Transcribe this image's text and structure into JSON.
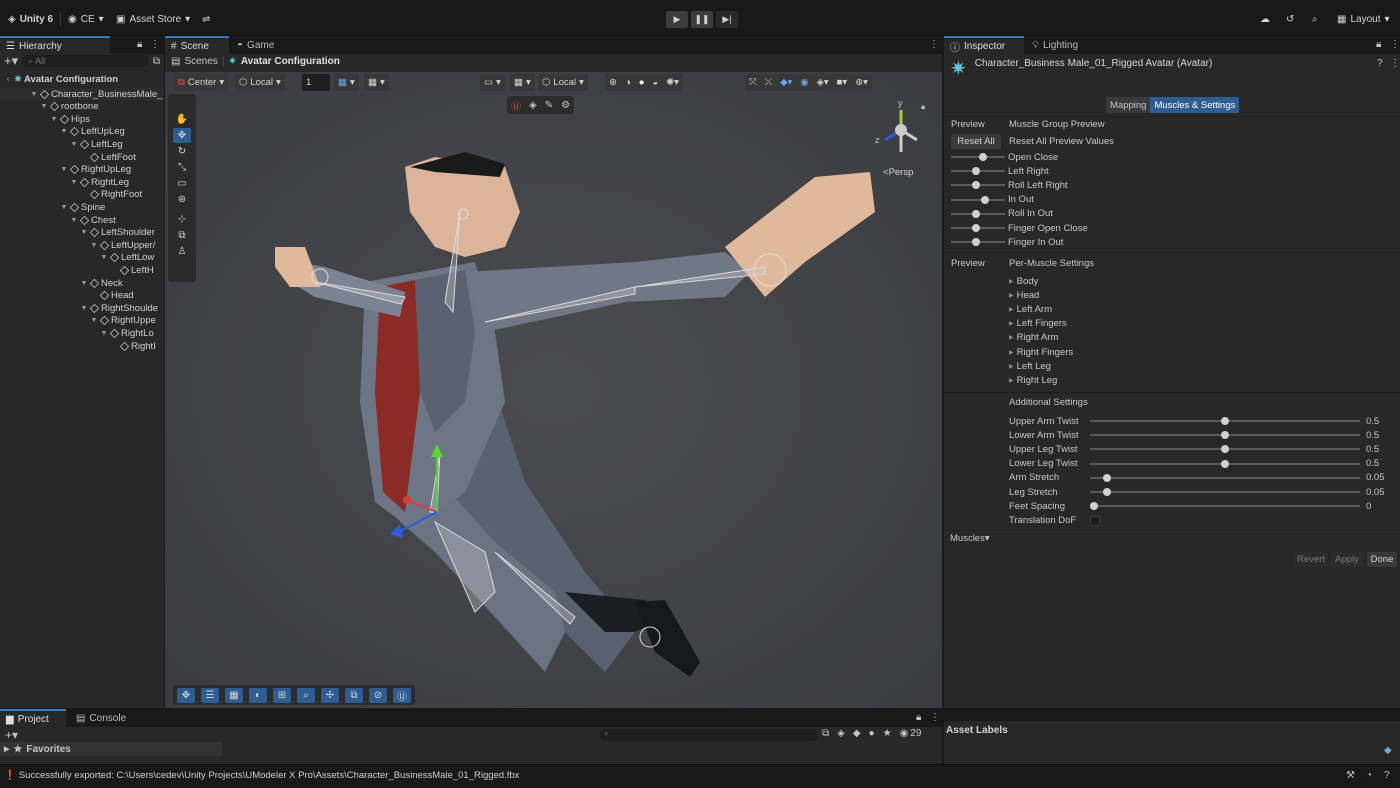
{
  "topbar": {
    "account": "Unity 6",
    "ce": "CE",
    "asset_store": "Asset Store",
    "layout": "Layout"
  },
  "hierarchy": {
    "tab": "Hierarchy",
    "search_placeholder": "All",
    "root": "Avatar Configuration",
    "items": [
      {
        "label": "Character_BusinessMale_",
        "depth": 0
      },
      {
        "label": "rootbone",
        "depth": 1
      },
      {
        "label": "Hips",
        "depth": 2
      },
      {
        "label": "LeftUpLeg",
        "depth": 3
      },
      {
        "label": "LeftLeg",
        "depth": 4
      },
      {
        "label": "LeftFoot",
        "depth": 5
      },
      {
        "label": "RightUpLeg",
        "depth": 3
      },
      {
        "label": "RightLeg",
        "depth": 4
      },
      {
        "label": "RightFoot",
        "depth": 5
      },
      {
        "label": "Spine",
        "depth": 3
      },
      {
        "label": "Chest",
        "depth": 4
      },
      {
        "label": "LeftShoulder",
        "depth": 5
      },
      {
        "label": "LeftUpper/",
        "depth": 6
      },
      {
        "label": "LeftLow",
        "depth": 7
      },
      {
        "label": "LeftH",
        "depth": 8
      },
      {
        "label": "Neck",
        "depth": 5
      },
      {
        "label": "Head",
        "depth": 6
      },
      {
        "label": "RightShoulde",
        "depth": 5
      },
      {
        "label": "RightUppe",
        "depth": 6
      },
      {
        "label": "RightLo",
        "depth": 7
      },
      {
        "label": "RightI",
        "depth": 8
      }
    ]
  },
  "scene": {
    "tab_scene": "Scene",
    "tab_game": "Game",
    "crumb_scenes": "Scenes",
    "crumb_current": "Avatar Configuration",
    "pivot": "Center",
    "space": "Local",
    "snap_value": "1",
    "handle_space": "Local",
    "gizmo_label": "Persp",
    "axis_y": "y",
    "axis_z": "z"
  },
  "inspector": {
    "tab_inspector": "Inspector",
    "tab_lighting": "Lighting",
    "title": "Character_Business Male_01_Rigged Avatar (Avatar)",
    "tab_mapping": "Mapping",
    "tab_muscles": "Muscles & Settings",
    "preview_label": "Preview",
    "muscle_group_preview": "Muscle Group Preview",
    "reset_all": "Reset All",
    "reset_all_preview": "Reset All Preview Values",
    "group_sliders": [
      {
        "label": "Open Close",
        "v": 0.6
      },
      {
        "label": "Left Right",
        "v": 0.45
      },
      {
        "label": "Roll Left Right",
        "v": 0.45
      },
      {
        "label": "In Out",
        "v": 0.65
      },
      {
        "label": "Roll In Out",
        "v": 0.45
      },
      {
        "label": "Finger Open Close",
        "v": 0.45
      },
      {
        "label": "Finger In Out",
        "v": 0.45
      }
    ],
    "preview_label2": "Preview",
    "per_muscle": "Per-Muscle Settings",
    "muscles": [
      "Body",
      "Head",
      "Left Arm",
      "Left Fingers",
      "Right Arm",
      "Right Fingers",
      "Left Leg",
      "Right Leg"
    ],
    "additional": "Additional Settings",
    "settings": [
      {
        "label": "Upper Arm Twist",
        "value": "0.5",
        "v": 0.5
      },
      {
        "label": "Lower Arm Twist",
        "value": "0.5",
        "v": 0.5
      },
      {
        "label": "Upper Leg Twist",
        "value": "0.5",
        "v": 0.5
      },
      {
        "label": "Lower Leg Twist",
        "value": "0.5",
        "v": 0.5
      },
      {
        "label": "Arm Stretch",
        "value": "0.05",
        "v": 0.05
      },
      {
        "label": "Leg Stretch",
        "value": "0.05",
        "v": 0.05
      },
      {
        "label": "Feet Spacing",
        "value": "0",
        "v": 0
      }
    ],
    "translation_dof": "Translation DoF",
    "muscles_dropdown": "Muscles",
    "revert": "Revert",
    "apply": "Apply",
    "done": "Done",
    "asset_labels": "Asset Labels"
  },
  "project": {
    "tab_project": "Project",
    "tab_console": "Console",
    "favorites": "Favorites",
    "count": "29"
  },
  "status": {
    "message": "Successfully exported: C:\\Users\\cedev\\Unity Projects\\UModeler X Pro\\Assets\\Character_BusinessMale_01_Rigged.fbx"
  },
  "colors": {
    "accent": "#3a79bb",
    "active_tab": "#2f5d92",
    "suit": "#5a6675",
    "tie": "#8e2a27",
    "skin": "#e2b89a"
  }
}
